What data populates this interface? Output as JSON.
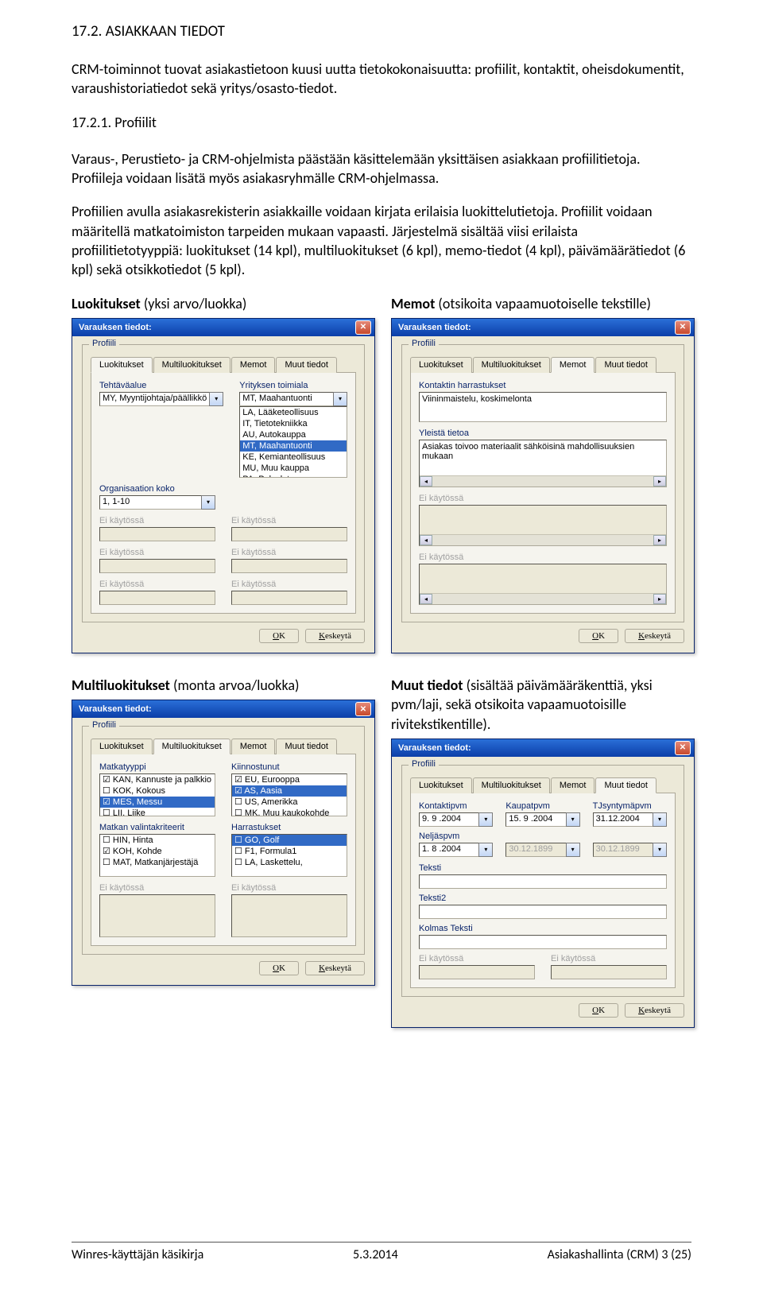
{
  "doc": {
    "section_heading": "17.2. ASIAKKAAN TIEDOT",
    "p1": "CRM-toiminnot tuovat asiakastietoon kuusi uutta tietokokonaisuutta: profiilit, kontaktit, oheisdokumentit, varaushistoriatiedot sekä yritys/osasto-tiedot.",
    "sub1": "17.2.1. Profiilit",
    "p2": "Varaus-, Perustieto- ja CRM-ohjelmista päästään käsittelemään yksittäisen asiakkaan profiilitietoja. Profiileja voidaan lisätä myös asiakasryhmälle CRM-ohjelmassa.",
    "p3": "Profiilien avulla asiakasrekisterin asiakkaille voidaan kirjata erilaisia luokittelutietoja. Profiilit voidaan määritellä matkatoimiston tarpeiden mukaan vapaasti. Järjestelmä sisältää viisi erilaista profiilitietotyyppiä: luokitukset (14 kpl), multiluokitukset (6 kpl), memo-tiedot (4 kpl), päivämäärätiedot (6 kpl) sekä otsikkotiedot (5 kpl).",
    "h_luok": "Luokitukset",
    "h_luok_sub": " (yksi arvo/luokka)",
    "h_memo": "Memot",
    "h_memo_sub": " (otsikoita vapaamuotoiselle tekstille)",
    "h_multi": "Multiluokitukset",
    "h_multi_sub": " (monta arvoa/luokka)",
    "h_muut": "Muut tiedot",
    "h_muut_sub": " (sisältää päivämääräkenttiä, yksi pvm/laji, sekä otsikoita vapaamuotoisille rivitekstikentille)."
  },
  "common": {
    "title": "Varauksen tiedot:",
    "group": "Profiili",
    "tabs": {
      "luok": "Luokitukset",
      "multi": "Multiluokitukset",
      "memot": "Memot",
      "muut": "Muut tiedot"
    },
    "ei": "Ei käytössä",
    "ok": "OK",
    "ok_u": "O",
    "ok_rest": "K",
    "cancel": "Keskeytä",
    "cancel_u": "K",
    "cancel_rest": "eskeytä"
  },
  "luok": {
    "tehtava_label": "Tehtäväalue",
    "tehtava_value": "MY, Myyntijohtaja/päällikkö",
    "org_label": "Organisaation koko",
    "org_value": "1, 1-10",
    "yrit_label": "Yrityksen toimiala",
    "yrit_value": "MT, Maahantuonti",
    "yrit_list": [
      "LA, Lääketeollisuus",
      "IT, Tietotekniikka",
      "AU, Autokauppa",
      "MT, Maahantuonti",
      "KE, Kemianteollisuus",
      "MU, Muu kauppa",
      "PA, Palvelut"
    ],
    "yrit_sel_idx": 3
  },
  "memo": {
    "f1_label": "Kontaktin harrastukset",
    "f1_value": "Viininmaistelu, koskimelonta",
    "f2_label": "Yleistä tietoa",
    "f2_value": "Asiakas toivoo materiaalit sähköisinä mahdollisuuksien mukaan"
  },
  "multi": {
    "c1_label": "Matkatyyppi",
    "c1_list": [
      "KAN, Kannuste ja palkkio",
      "KOK, Kokous",
      "MES, Messu",
      "LII, Liike"
    ],
    "c1_sel": [
      0,
      2
    ],
    "c2_label": "Matkan valintakriteerit",
    "c2_list": [
      "HIN, Hinta",
      "KOH, Kohde",
      "MAT, Matkanjärjestäjä"
    ],
    "c2_sel": [
      1
    ],
    "c3_label": "Kiinnostunut",
    "c3_list": [
      "EU, Eurooppa",
      "AS, Aasia",
      "US, Amerikka",
      "MK, Muu kaukokohde"
    ],
    "c3_sel": [
      0,
      1
    ],
    "c3_hl": 1,
    "c4_label": "Harrastukset",
    "c4_list": [
      "GO, Golf",
      "F1, Formula1",
      "LA, Laskettelu,"
    ],
    "c4_hl": 0
  },
  "muut": {
    "kontakti_l": "Kontaktipvm",
    "kontakti_v": "9. 9 .2004",
    "kaupat_l": "Kaupatpvm",
    "kaupat_v": "15. 9 .2004",
    "tjs_l": "TJsyntymäpvm",
    "tjs_v": "31.12.2004",
    "nelj_l": "Neljäspvm",
    "nelj_v": "1. 8 .2004",
    "gray_v": "30.12.1899",
    "t1": "Teksti",
    "t2": "Teksti2",
    "t3": "Kolmas Teksti"
  },
  "footer": {
    "left": "Winres-käyttäjän käsikirja",
    "mid": "5.3.2014",
    "right": "Asiakashallinta (CRM)  3 (25)"
  }
}
